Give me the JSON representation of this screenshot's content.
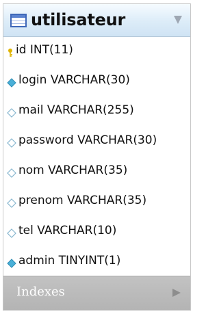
{
  "table": {
    "name": "utilisateur",
    "fields": [
      {
        "label": "id INT(11)",
        "icon": "primary-key-icon"
      },
      {
        "label": "login VARCHAR(30)",
        "icon": "indexed-field-icon"
      },
      {
        "label": "mail VARCHAR(255)",
        "icon": "field-icon"
      },
      {
        "label": "password VARCHAR(30)",
        "icon": "field-icon"
      },
      {
        "label": "nom VARCHAR(35)",
        "icon": "field-icon"
      },
      {
        "label": "prenom VARCHAR(35)",
        "icon": "field-icon"
      },
      {
        "label": "tel VARCHAR(10)",
        "icon": "field-icon"
      },
      {
        "label": "admin TINYINT(1)",
        "icon": "indexed-field-icon"
      }
    ],
    "indexes_label": "Indexes"
  },
  "colors": {
    "header_accent": "#cfe3f4",
    "indexed_icon": "#4ab0d8",
    "field_icon_outline": "#88b7cf",
    "primary_key": "#e0b400",
    "indexes_bar": "#b8b8b8"
  }
}
